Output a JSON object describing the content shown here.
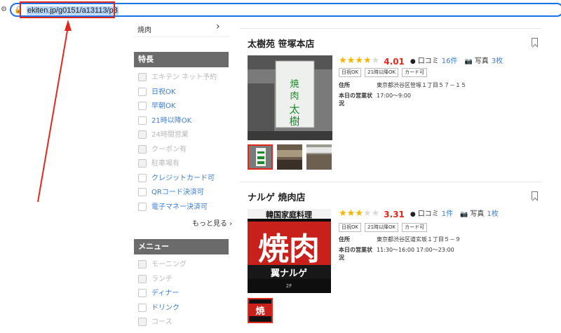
{
  "browser": {
    "url": "ekiten.jp/g0151/a13113/p3"
  },
  "sidebar": {
    "genre_item": "焼肉",
    "features_header": "特長",
    "features": [
      {
        "label": "エキテン ネット予約",
        "enabled": false
      },
      {
        "label": "日祝OK",
        "enabled": true
      },
      {
        "label": "早朝OK",
        "enabled": true
      },
      {
        "label": "21時以降OK",
        "enabled": true
      },
      {
        "label": "24時間営業",
        "enabled": false
      },
      {
        "label": "クーポン有",
        "enabled": false
      },
      {
        "label": "駐車場有",
        "enabled": false
      },
      {
        "label": "クレジットカード可",
        "enabled": true
      },
      {
        "label": "QRコード決済可",
        "enabled": true
      },
      {
        "label": "電子マネー決済可",
        "enabled": true
      }
    ],
    "more_label": "もっと見る",
    "menu_header": "メニュー",
    "menu": [
      {
        "label": "モーニング",
        "enabled": false
      },
      {
        "label": "ランチ",
        "enabled": false
      },
      {
        "label": "ディナー",
        "enabled": true
      },
      {
        "label": "ドリンク",
        "enabled": true
      },
      {
        "label": "コース",
        "enabled": false
      }
    ]
  },
  "shops": [
    {
      "name": "太樹苑 笹塚本店",
      "rating": 4.01,
      "stars": 4,
      "score": "4.01",
      "review_label": "口コミ",
      "review_count": "16件",
      "photo_label": "写真",
      "photo_count": "3枚",
      "tags": [
        "日祝OK",
        "21時以降OK",
        "カード可"
      ],
      "address_label": "住所",
      "address": "東京都渋谷区笹塚１丁目５７－１５",
      "hours_label": "本日の営業状況",
      "hours": "17:00〜9:00",
      "sign_text": "焼肉 太樹苑"
    },
    {
      "name": "ナルゲ 焼肉店",
      "rating": 3.31,
      "stars": 3,
      "score": "3.31",
      "review_label": "口コミ",
      "review_count": "1件",
      "photo_label": "写真",
      "photo_count": "1枚",
      "tags": [
        "日祝OK",
        "21時以降OK",
        "カード可"
      ],
      "address_label": "住所",
      "address": "東京都渋谷区道玄坂１丁目５－９",
      "hours_label": "本日の営業状況",
      "hours": "11:30〜16:00 17:00〜23:00",
      "sign_text": "焼肉"
    }
  ],
  "colors": {
    "accent_blue": "#1a73e8",
    "annotation_red": "#e0281e",
    "star": "#f4b400",
    "link": "#3b7dd8"
  }
}
